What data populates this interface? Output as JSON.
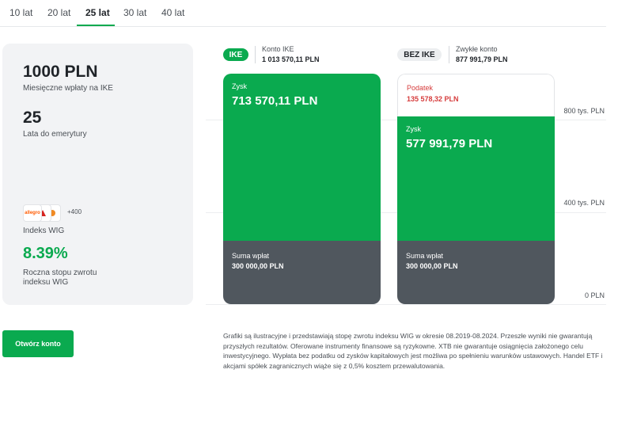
{
  "tabs": [
    {
      "label": "10 lat",
      "active": false
    },
    {
      "label": "20 lat",
      "active": false
    },
    {
      "label": "25 lat",
      "active": true
    },
    {
      "label": "30 lat",
      "active": false
    },
    {
      "label": "40 lat",
      "active": false
    }
  ],
  "summary": {
    "monthly_amount": "1000 PLN",
    "monthly_label": "Miesięczne wpłaty na IKE",
    "years": "25",
    "years_label": "Lata do emerytury",
    "logos": [
      "allegro",
      "logo-2",
      "logo-3"
    ],
    "logos_more": "+400",
    "index_label": "Indeks WIG",
    "return_rate": "8.39%",
    "return_label_line1": "Roczna stopu zwrotu",
    "return_label_line2": "indeksu WIG"
  },
  "cta": {
    "label": "Otwórz konto"
  },
  "chart": {
    "y_ticks": [
      "800 tys. PLN",
      "400 tys. PLN",
      "0 PLN"
    ],
    "ike": {
      "pill": "IKE",
      "account_label": "Konto IKE",
      "account_total": "1 013 570,11 PLN",
      "profit_label": "Zysk",
      "profit_value": "713 570,11 PLN",
      "deposit_label": "Suma wpłat",
      "deposit_value": "300 000,00 PLN"
    },
    "bez_ike": {
      "pill": "BEZ IKE",
      "account_label": "Zwykłe konto",
      "account_total": "877 991,79 PLN",
      "tax_label": "Podatek",
      "tax_value": "135 578,32 PLN",
      "profit_label": "Zysk",
      "profit_value": "577 991,79 PLN",
      "deposit_label": "Suma wpłat",
      "deposit_value": "300 000,00 PLN"
    }
  },
  "colors": {
    "accent": "#0aaa4f",
    "deposit": "#50575e",
    "tax": "#d63c3c"
  },
  "disclaimer": "Grafiki są ilustracyjne i przedstawiają stopę zwrotu indeksu WIG w okresie 08.2019-08.2024. Przeszłe wyniki nie gwarantują przyszłych rezultatów. Oferowane instrumenty finansowe są ryzykowne. XTB nie gwarantuje osiągnięcia założonego celu inwestycyjnego. Wypłata bez podatku od zysków kapitałowych jest możliwa po spełnieniu warunków ustawowych. Handel ETF i akcjami spółek zagranicznych wiąże się z 0,5% kosztem przewalutowania."
}
